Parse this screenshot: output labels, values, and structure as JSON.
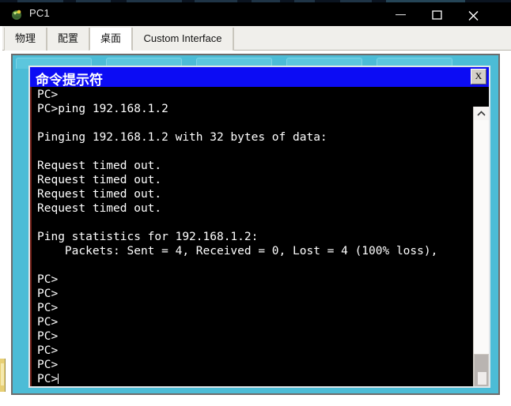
{
  "window": {
    "title": "PC1",
    "icon": "packet-tracer-pc-icon",
    "controls": {
      "minimize_label": "–",
      "maximize_label": "□",
      "close_label": "×"
    }
  },
  "tabs": [
    {
      "label": "物理",
      "selected": false
    },
    {
      "label": "配置",
      "selected": false
    },
    {
      "label": "桌面",
      "selected": true
    },
    {
      "label": "Custom Interface",
      "selected": false
    }
  ],
  "terminal": {
    "title": "命令提示符",
    "close_label": "X",
    "lines": [
      "PC>",
      "PC>ping 192.168.1.2",
      "",
      "Pinging 192.168.1.2 with 32 bytes of data:",
      "",
      "Request timed out.",
      "Request timed out.",
      "Request timed out.",
      "Request timed out.",
      "",
      "Ping statistics for 192.168.1.2:",
      "    Packets: Sent = 4, Received = 0, Lost = 4 (100% loss),",
      "",
      "PC>",
      "PC>",
      "PC>",
      "PC>",
      "PC>",
      "PC>",
      "PC>"
    ],
    "prompt_last": "PC>",
    "scrollbar": {
      "up_arrow": "chevron-up-icon",
      "down_arrow": "chevron-down-icon"
    }
  },
  "colors": {
    "desktop": "#4cbcd6",
    "terminal_title_bar": "#0c0cf4",
    "terminal_background": "#000000",
    "terminal_text": "#ffffff",
    "app_titlebar": "#000000"
  }
}
